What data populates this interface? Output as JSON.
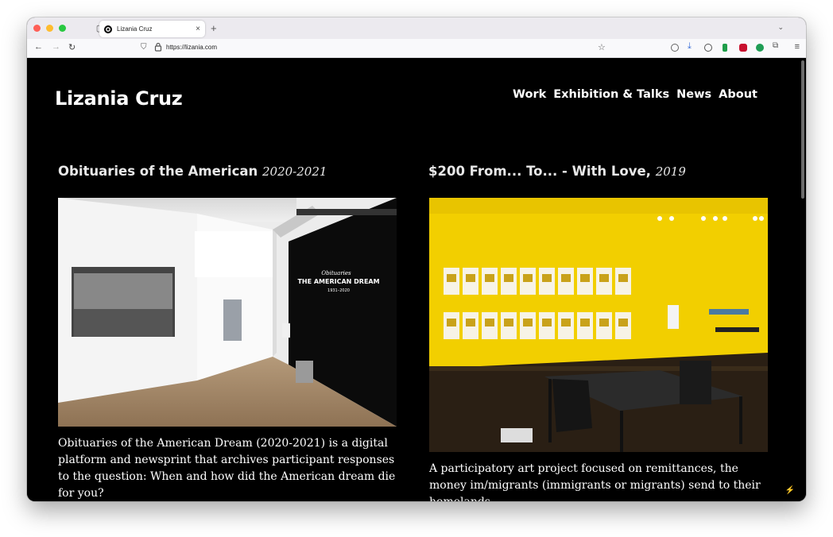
{
  "browser": {
    "tab_title": "Lizania Cruz",
    "url": "https://lizania.com"
  },
  "site": {
    "title": "Lizania Cruz",
    "nav": [
      "Work",
      "Exhibition & Talks",
      "News",
      "About"
    ]
  },
  "cards": [
    {
      "title": "Obituaries of the American",
      "year": "2020-2021",
      "wall_text_line1": "Obituaries",
      "wall_text_line2": "THE AMERICAN DREAM",
      "wall_text_line3": "1931–2020",
      "description": "Obituaries of the American Dream (2020-2021) is a digital platform and newsprint that archives participant responses to the question: When and how did the American dream die for you?"
    },
    {
      "title": "$200 From... To... - With Love,",
      "year": "2019",
      "description": "A participatory art project focused on remittances, the money im/migrants (immigrants or migrants) send to their homelands."
    }
  ],
  "colors": {
    "page_bg": "#000000",
    "wall_yellow": "#f2cf00",
    "text": "#ffffff"
  }
}
